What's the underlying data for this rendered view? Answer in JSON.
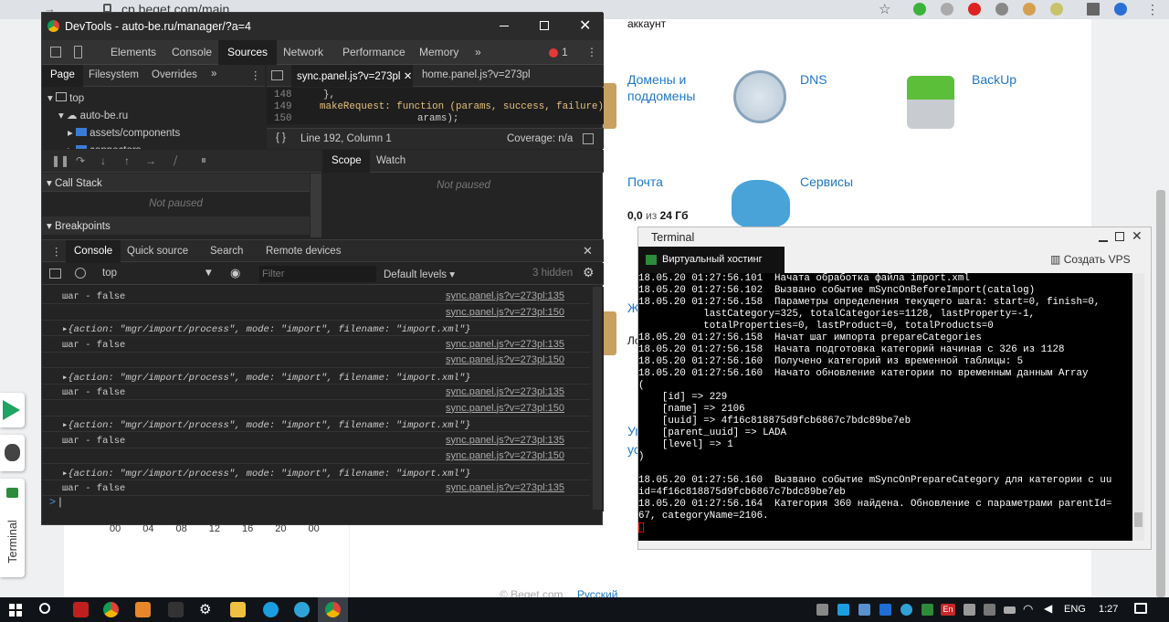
{
  "browser": {
    "url": "cp.beget.com/main"
  },
  "beget": {
    "top_label": "аккаунт",
    "services": [
      {
        "label": "Домены и поддомены"
      },
      {
        "label": "DNS"
      },
      {
        "label": "BackUp"
      },
      {
        "label": "Почта"
      },
      {
        "label": "Сервисы"
      }
    ],
    "mail_value": "0,0",
    "mail_of": "из",
    "mail_total": "24 Гб",
    "partial_left": "Ж",
    "partial_left2": "Ло",
    "partial_left3": "Уг",
    "partial_left4": "ус",
    "time_ticks": [
      "00",
      "04",
      "08",
      "12",
      "16",
      "20",
      "00"
    ],
    "footer_copy": "© Beget.com",
    "footer_lang": "Русский"
  },
  "devtools": {
    "title": "DevTools - auto-be.ru/manager/?a=4",
    "tabs": [
      "Elements",
      "Console",
      "Sources",
      "Network",
      "Performance",
      "Memory"
    ],
    "active_tab": "Sources",
    "more": "»",
    "error_count": "1",
    "nav_tabs": [
      "Page",
      "Filesystem",
      "Overrides"
    ],
    "tree": [
      "top",
      "auto-be.ru",
      "assets/components",
      "connectors"
    ],
    "file_tabs": [
      "sync.panel.js?v=273pl",
      "home.panel.js?v=273pl"
    ],
    "code_lines": [
      {
        "num": "148",
        "code": "},"
      },
      {
        "num": "149",
        "code": "makeRequest: function (params, success, failure) {"
      },
      {
        "num": "150",
        "code": "arams);"
      }
    ],
    "cursor": "Line 192, Column 1",
    "coverage": "Coverage: n/a",
    "call_stack": "Call Stack",
    "not_paused": "Not paused",
    "breakpoints": "Breakpoints",
    "scope_tabs": [
      "Scope",
      "Watch"
    ],
    "scope_not_paused": "Not paused",
    "drawer_tabs": [
      "Console",
      "Quick source",
      "Search",
      "Remote devices"
    ],
    "context": "top",
    "filter_placeholder": "Filter",
    "levels": "Default levels ▾",
    "hidden": "3 hidden",
    "console": [
      {
        "text": "шаг - false",
        "link": "sync.panel.js?v=273pl:135"
      },
      {
        "text": "",
        "link": "sync.panel.js?v=273pl:150"
      },
      {
        "text": "▸{action: \"mgr/import/process\", mode: \"import\", filename: \"import.xml\"}",
        "link": ""
      },
      {
        "text": "шаг - false",
        "link": "sync.panel.js?v=273pl:135"
      },
      {
        "text": "",
        "link": "sync.panel.js?v=273pl:150"
      },
      {
        "text": "▸{action: \"mgr/import/process\", mode: \"import\", filename: \"import.xml\"}",
        "link": ""
      },
      {
        "text": "шаг - false",
        "link": "sync.panel.js?v=273pl:135"
      },
      {
        "text": "",
        "link": "sync.panel.js?v=273pl:150"
      },
      {
        "text": "▸{action: \"mgr/import/process\", mode: \"import\", filename: \"import.xml\"}",
        "link": ""
      },
      {
        "text": "шаг - false",
        "link": "sync.panel.js?v=273pl:135"
      },
      {
        "text": "",
        "link": "sync.panel.js?v=273pl:150"
      },
      {
        "text": "▸{action: \"mgr/import/process\", mode: \"import\", filename: \"import.xml\"}",
        "link": ""
      },
      {
        "text": "шаг - false",
        "link": "sync.panel.js?v=273pl:135"
      }
    ],
    "prompt": ">"
  },
  "terminal": {
    "title": "Terminal",
    "tab": "Виртуальный хостинг",
    "create_vps": "Создать VPS",
    "lines": [
      "18.05.20 01:27:56.101  Начата обработка файла import.xml",
      "18.05.20 01:27:56.102  Вызвано событие mSyncOnBeforeImport(catalog)",
      "18.05.20 01:27:56.158  Параметры определения текущего шага: start=0, finish=0,",
      "           lastCategory=325, totalCategories=1128, lastProperty=-1,",
      "           totalProperties=0, lastProduct=0, totalProducts=0",
      "18.05.20 01:27:56.158  Начат шаг импорта prepareCategories",
      "18.05.20 01:27:56.158  Начата подготовка категорий начиная с 326 из 1128",
      "18.05.20 01:27:56.160  Получено категорий из временной таблицы: 5",
      "18.05.20 01:27:56.160  Начато обновление категории по временным данным Array",
      "(",
      "    [id] => 229",
      "    [name] => 2106",
      "    [uuid] => 4f16c818875d9fcb6867c7bdc89be7eb",
      "    [parent_uuid] => LADA",
      "    [level] => 1",
      ")",
      "",
      "18.05.20 01:27:56.160  Вызвано событие mSyncOnPrepareCategory для категории с uu",
      "id=4f16c818875d9fcb6867c7bdc89be7eb",
      "18.05.20 01:27:56.164  Категория 360 найдена. Обновление с параметрами parentId=",
      "67, categoryName=2106."
    ]
  },
  "dock": {
    "terminal_label": "Terminal"
  },
  "taskbar": {
    "lang": "ENG",
    "time": "1:27",
    "tray_en": "En"
  }
}
